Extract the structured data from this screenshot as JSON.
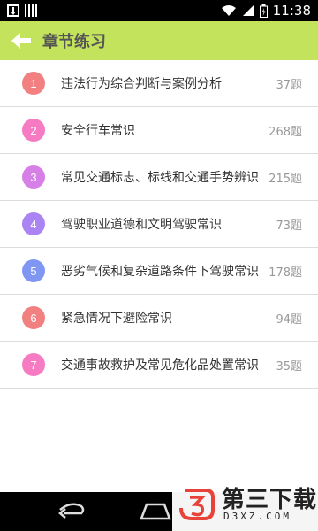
{
  "status_bar": {
    "time": "11:38"
  },
  "app_bar": {
    "title": "章节练习"
  },
  "chapters": [
    {
      "number": "1",
      "title": "违法行为综合判断与案例分析",
      "count": "37题",
      "color": "#f06b6b"
    },
    {
      "number": "2",
      "title": "安全行车常识",
      "count": "268题",
      "color": "#f565b9"
    },
    {
      "number": "3",
      "title": "常见交通标志、标线和交通手势辨识",
      "count": "215题",
      "color": "#d06ae3"
    },
    {
      "number": "4",
      "title": "驾驶职业道德和文明驾驶常识",
      "count": "73题",
      "color": "#9b6ff0"
    },
    {
      "number": "5",
      "title": "恶劣气候和复杂道路条件下驾驶常识",
      "count": "178题",
      "color": "#6b84f2"
    },
    {
      "number": "6",
      "title": "紧急情况下避险常识",
      "count": "94题",
      "color": "#f06b6b"
    },
    {
      "number": "7",
      "title": "交通事故救护及常见危化品处置常识",
      "count": "35题",
      "color": "#f565b9"
    }
  ],
  "watermark": {
    "text": "第三下载",
    "url": "D3XZ.COM"
  },
  "colors": {
    "app_bar": "#c2e35b",
    "divider": "#dcdcdc"
  }
}
